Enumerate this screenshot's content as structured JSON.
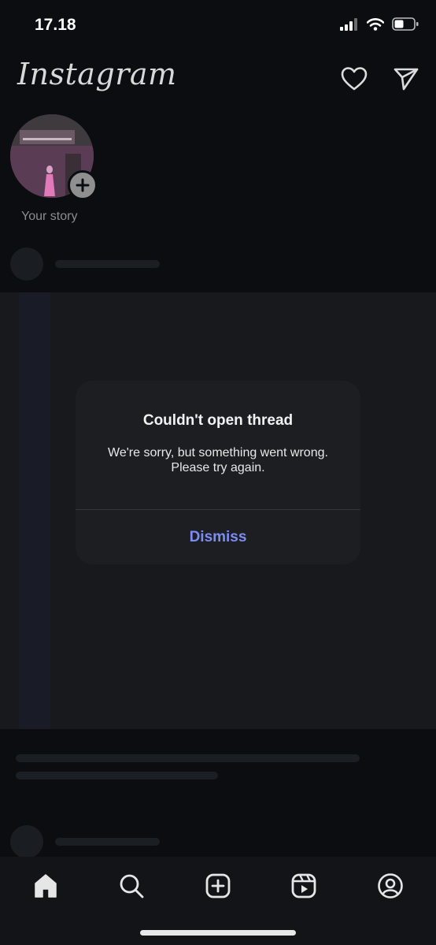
{
  "status_bar": {
    "time": "17.18",
    "icons": [
      "cellular-signal-icon",
      "wifi-icon",
      "battery-icon"
    ]
  },
  "header": {
    "logo": "Instagram",
    "actions": [
      "heart-icon",
      "paper-plane-icon"
    ]
  },
  "story": {
    "label": "Your story",
    "add_icon": "plus-icon"
  },
  "dialog": {
    "title": "Couldn't open thread",
    "message_line1": "We're sorry, but something went wrong.",
    "message_line2": "Please try again.",
    "dismiss_label": "Dismiss"
  },
  "bottom_nav": {
    "items": [
      "home-icon",
      "search-icon",
      "create-icon",
      "reels-icon",
      "profile-icon"
    ]
  },
  "colors": {
    "background": "#0b0d10",
    "dialog": "#1c1e21",
    "accent": "#7d8cf2"
  }
}
